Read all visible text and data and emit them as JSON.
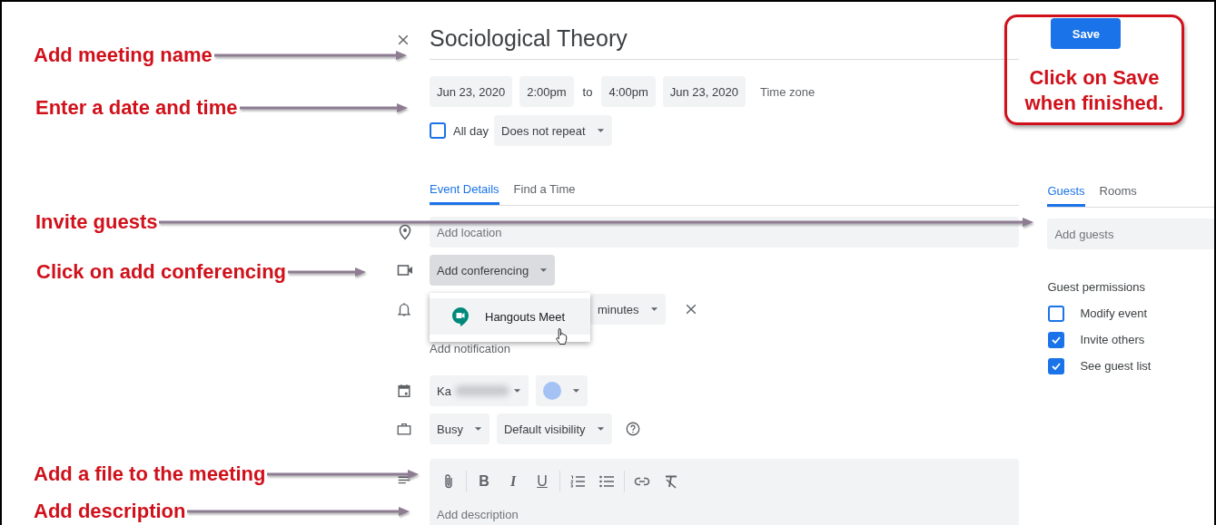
{
  "title": "Sociological Theory",
  "date_time": {
    "start_date": "Jun 23, 2020",
    "start_time": "2:00pm",
    "separator": "to",
    "end_time": "4:00pm",
    "end_date": "Jun 23, 2020",
    "time_zone": "Time zone"
  },
  "all_day": {
    "label": "All day",
    "checked": false
  },
  "repeat": "Does not repeat",
  "tabs": [
    {
      "label": "Event Details",
      "selected": true
    },
    {
      "label": "Find a Time",
      "selected": false
    }
  ],
  "location": {
    "placeholder": "Add location"
  },
  "conferencing": {
    "label": "Add conferencing",
    "expanded": true
  },
  "conferencing_menu": [
    {
      "label": "Hangouts Meet",
      "hovered": true
    }
  ],
  "notification": {
    "unit": "minutes"
  },
  "add_notification": "Add notification",
  "calendar": {
    "name": "Ka"
  },
  "availability": "Busy",
  "visibility": "Default visibility",
  "description": {
    "toolbar": [
      {
        "kind": "attach"
      },
      {
        "kind": "divider"
      },
      {
        "kind": "bold",
        "label": "B"
      },
      {
        "kind": "italic",
        "label": "I"
      },
      {
        "kind": "underline",
        "label": "U"
      },
      {
        "kind": "divider"
      },
      {
        "kind": "numbered"
      },
      {
        "kind": "bulleted"
      },
      {
        "kind": "divider"
      },
      {
        "kind": "link"
      },
      {
        "kind": "clear"
      }
    ],
    "placeholder": "Add description"
  },
  "save_button": "Save",
  "guest_tabs": [
    {
      "label": "Guests",
      "selected": true
    },
    {
      "label": "Rooms",
      "selected": false
    }
  ],
  "guests": {
    "placeholder": "Add guests"
  },
  "guest_permissions": {
    "title": "Guest permissions",
    "items": [
      {
        "label": "Modify event",
        "checked": false
      },
      {
        "label": "Invite others",
        "checked": true
      },
      {
        "label": "See guest list",
        "checked": true
      }
    ]
  },
  "callout": "Click on Save when finished.",
  "annotations": [
    {
      "text": "Add meeting name"
    },
    {
      "text": "Enter a date and time"
    },
    {
      "text": "Invite guests"
    },
    {
      "text": "Click on add conferencing"
    },
    {
      "text": "Add a file to the meeting"
    },
    {
      "text": "Add description"
    }
  ]
}
